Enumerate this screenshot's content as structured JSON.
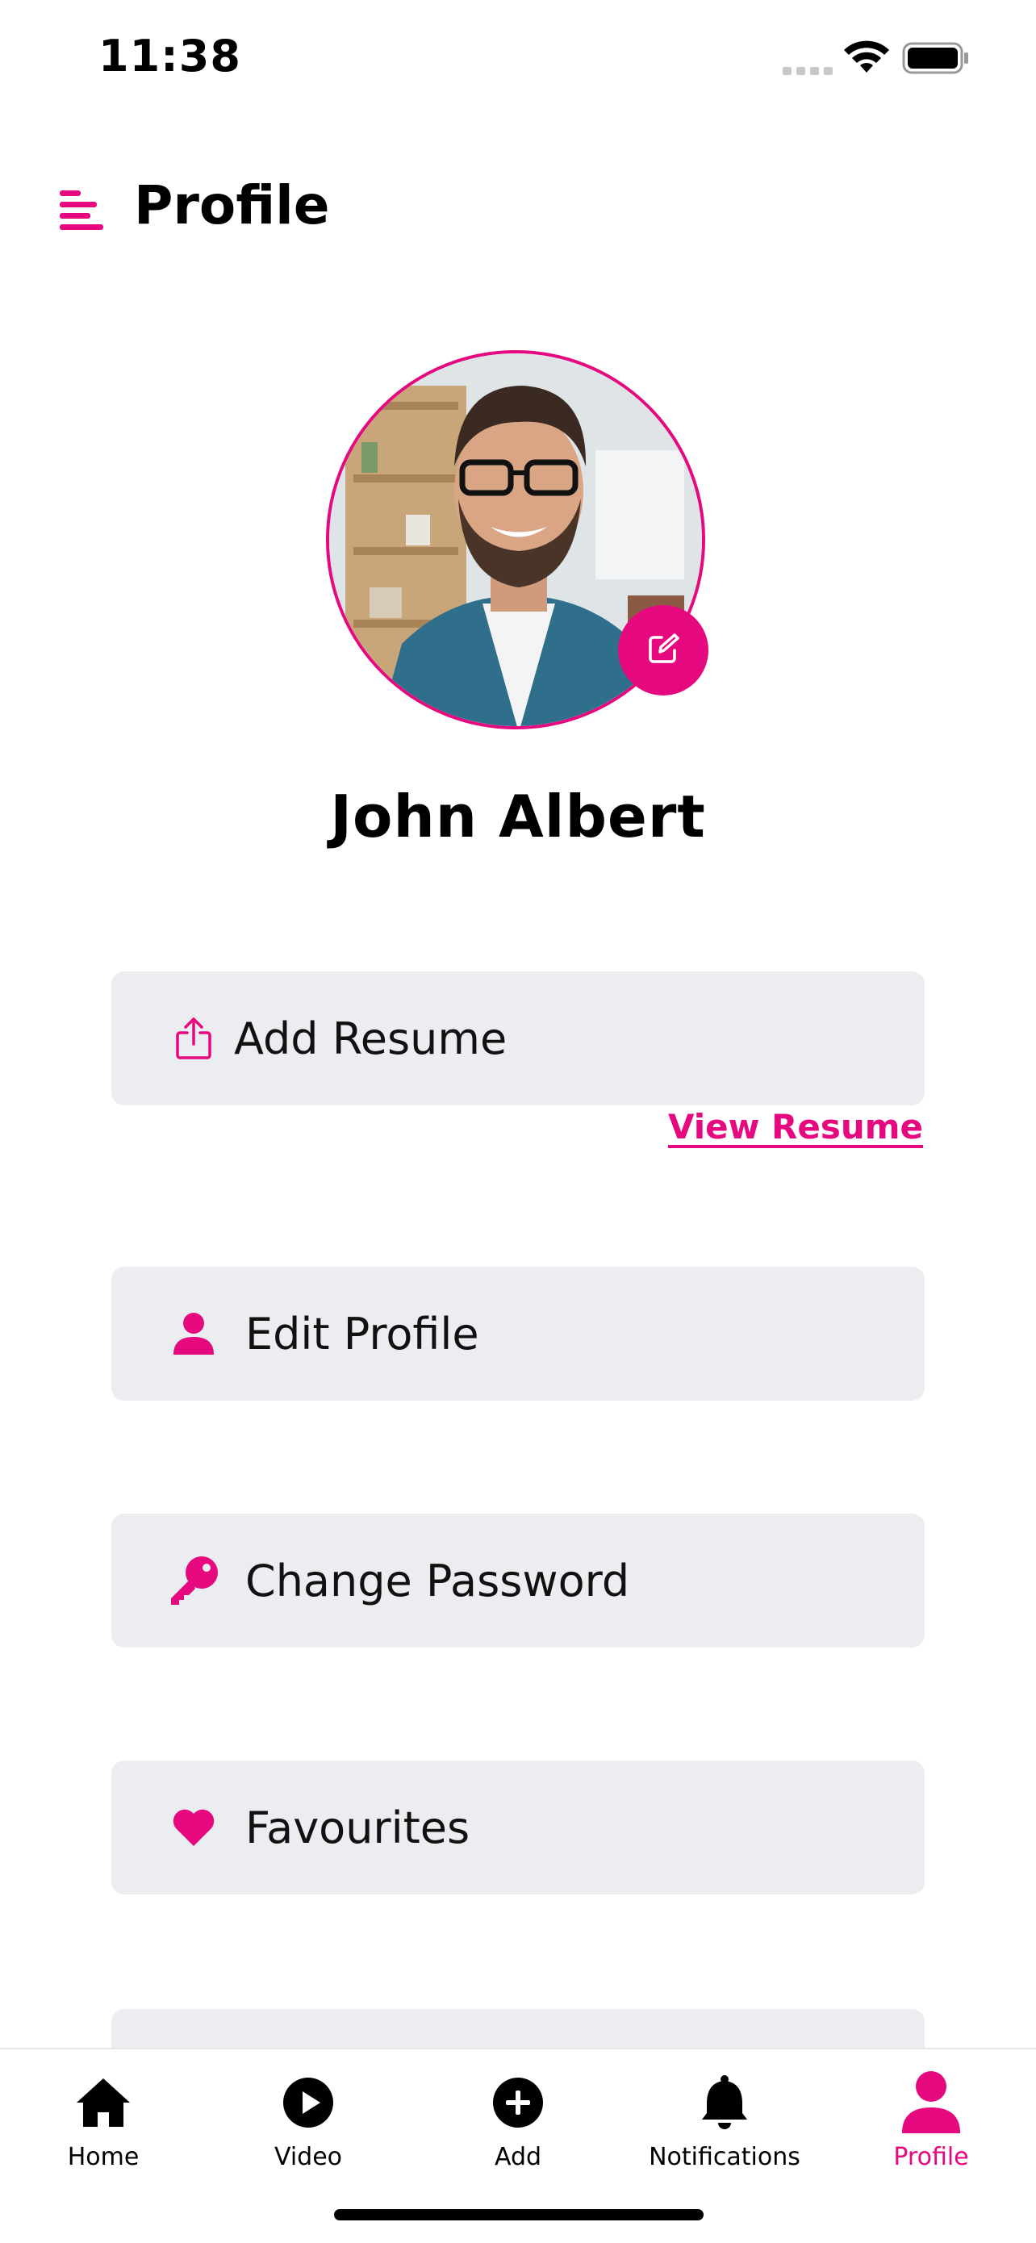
{
  "status_bar": {
    "time": "11:38"
  },
  "header": {
    "title": "Profile",
    "menu_icon": "menu-lines-icon"
  },
  "profile": {
    "name": "John Albert",
    "edit_icon": "edit-square-icon"
  },
  "menu": {
    "add_resume": {
      "label": "Add Resume",
      "icon": "upload-icon"
    },
    "view_resume": "View Resume",
    "edit_profile": {
      "label": "Edit Profile",
      "icon": "person-icon"
    },
    "change_password": {
      "label": "Change Password",
      "icon": "key-icon"
    },
    "favourites": {
      "label": "Favourites",
      "icon": "heart-icon"
    }
  },
  "tabbar": {
    "home": "Home",
    "video": "Video",
    "add": "Add",
    "notifications": "Notifications",
    "profile": "Profile",
    "active": "Profile"
  },
  "colors": {
    "accent": "#E5087E",
    "card_bg": "#EBEDF1"
  }
}
